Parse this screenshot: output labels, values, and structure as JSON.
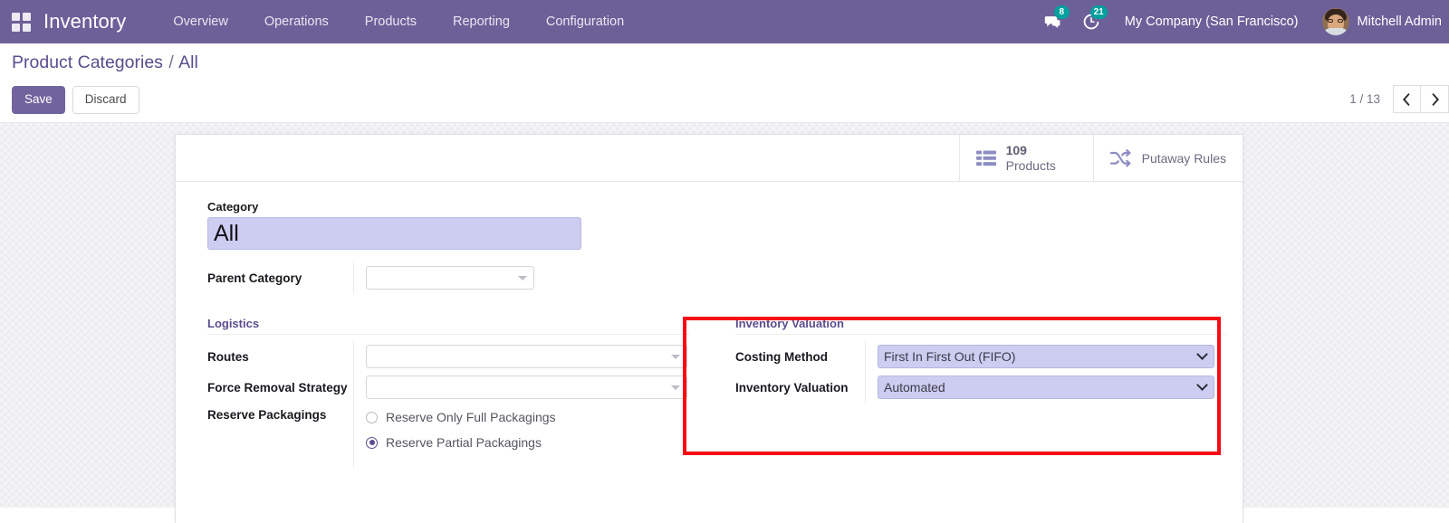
{
  "navbar": {
    "apps_icon": "apps-grid-icon",
    "brand": "Inventory",
    "menu": [
      {
        "label": "Overview"
      },
      {
        "label": "Operations"
      },
      {
        "label": "Products"
      },
      {
        "label": "Reporting"
      },
      {
        "label": "Configuration"
      }
    ],
    "messages": {
      "icon": "chat-bubble-icon",
      "count": "8"
    },
    "activities": {
      "icon": "clock-activity-icon",
      "count": "21"
    },
    "company": "My Company (San Francisco)",
    "user": "Mitchell Admin",
    "avatar_icon": "user-avatar",
    "accent": "#6d6099",
    "badge_color": "#00a09d"
  },
  "control_panel": {
    "breadcrumb_root": "Product Categories",
    "breadcrumb_sep": "/",
    "breadcrumb_leaf": "All",
    "save_label": "Save",
    "discard_label": "Discard",
    "pager_text": "1 / 13",
    "prev_icon": "chevron-left-icon",
    "next_icon": "chevron-right-icon"
  },
  "stat_buttons": [
    {
      "icon": "list-view-icon",
      "value": "109",
      "label": "Products"
    },
    {
      "icon": "shuffle-icon",
      "label": "Putaway Rules"
    }
  ],
  "form": {
    "category": {
      "label": "Category",
      "value": "All",
      "placeholder": ""
    },
    "parent_category": {
      "label": "Parent Category",
      "value": "",
      "placeholder": "",
      "dropdown_icon": "caret-down-icon"
    },
    "logistics": {
      "title": "Logistics",
      "routes": {
        "label": "Routes",
        "value": "",
        "placeholder": "",
        "dropdown_icon": "caret-down-icon"
      },
      "force_removal_strategy": {
        "label": "Force Removal Strategy",
        "value": "",
        "placeholder": "",
        "dropdown_icon": "caret-down-icon"
      },
      "reserve_packagings": {
        "label": "Reserve Packagings",
        "options": [
          {
            "label": "Reserve Only Full Packagings",
            "selected": false
          },
          {
            "label": "Reserve Partial Packagings",
            "selected": true
          }
        ]
      }
    },
    "inventory_valuation": {
      "title": "Inventory Valuation",
      "costing_method": {
        "label": "Costing Method",
        "value": "First In First Out (FIFO)",
        "chevron_icon": "chevron-down-icon"
      },
      "inventory_valuation": {
        "label": "Inventory Valuation",
        "value": "Automated",
        "chevron_icon": "chevron-down-icon"
      }
    }
  },
  "annotation": {
    "highlight_color": "#f50c15"
  }
}
